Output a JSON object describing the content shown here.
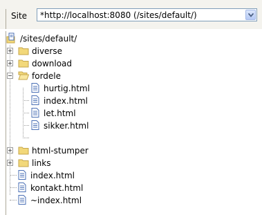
{
  "site": {
    "label": "Site",
    "selected": "*http://localhost:8080 (/sites/default/)"
  },
  "tree": {
    "root": "/sites/default/",
    "items": [
      {
        "label": "diverse",
        "type": "folder",
        "expanded": false
      },
      {
        "label": "download",
        "type": "folder",
        "expanded": false
      },
      {
        "label": "fordele",
        "type": "folder",
        "expanded": true,
        "children": [
          "hurtig.html",
          "index.html",
          "let.html",
          "sikker.html"
        ]
      },
      {
        "label": "html-stumper",
        "type": "folder",
        "expanded": false
      },
      {
        "label": "links",
        "type": "folder",
        "expanded": false
      },
      {
        "label": "index.html",
        "type": "file"
      },
      {
        "label": "kontakt.html",
        "type": "file"
      },
      {
        "label": "~index.html",
        "type": "file"
      }
    ]
  },
  "colors": {
    "folder": "#f2d87a",
    "folder_border": "#c6a64a",
    "file_line": "#4a6fb5",
    "tree_line": "#999999"
  }
}
